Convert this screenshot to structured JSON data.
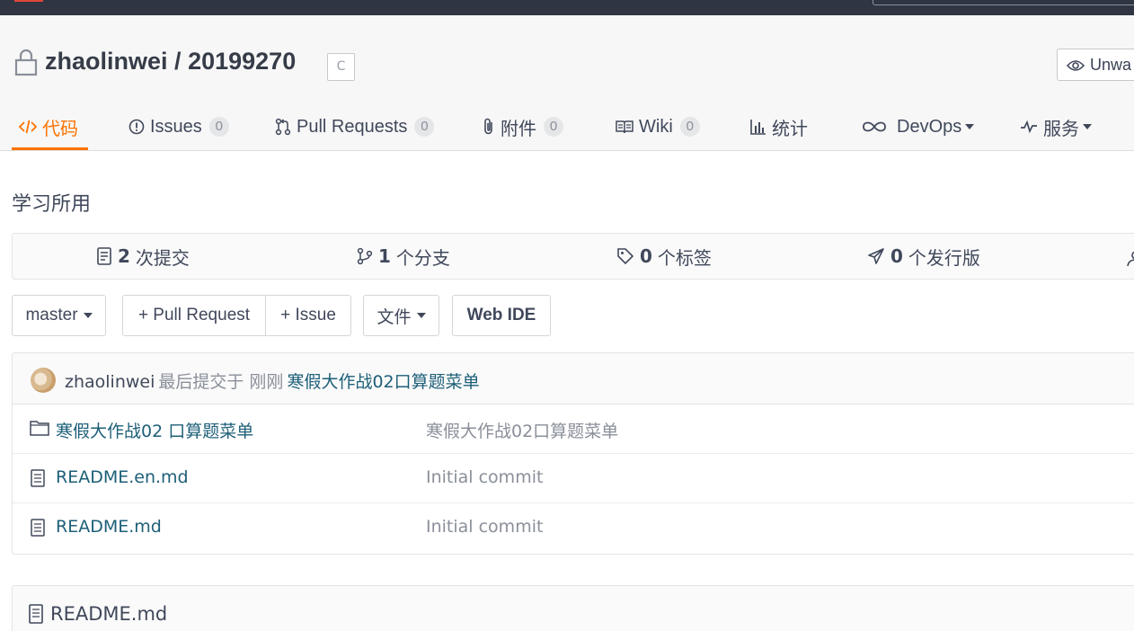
{
  "repo": {
    "owner": "zhaolinwei",
    "separator": "/",
    "name": "20199270",
    "badge": "C",
    "watch_label": "Unwa",
    "description": "学习所用"
  },
  "tabs": [
    {
      "label": "代码",
      "icon": "code-icon",
      "active": true
    },
    {
      "label": "Issues",
      "count": "0",
      "icon": "issue-icon"
    },
    {
      "label": "Pull Requests",
      "count": "0",
      "icon": "pull-request-icon"
    },
    {
      "label": "附件",
      "count": "0",
      "icon": "paperclip-icon"
    },
    {
      "label": "Wiki",
      "count": "0",
      "icon": "book-icon"
    },
    {
      "label": "统计",
      "icon": "bar-chart-icon"
    },
    {
      "label": "DevOps",
      "icon": "infinity-icon",
      "dropdown": true
    },
    {
      "label": "服务",
      "icon": "pulse-icon",
      "dropdown": true
    }
  ],
  "stats": [
    {
      "value": "2",
      "label": "次提交",
      "icon": "commit-log-icon"
    },
    {
      "value": "1",
      "label": "个分支",
      "icon": "branch-icon"
    },
    {
      "value": "0",
      "label": "个标签",
      "icon": "tag-icon"
    },
    {
      "value": "0",
      "label": "个发行版",
      "icon": "send-icon"
    }
  ],
  "toolbar": {
    "branch": "master",
    "pull_request": "+ Pull Request",
    "issue": "+ Issue",
    "file": "文件",
    "web_ide": "Web IDE"
  },
  "last_commit": {
    "author": "zhaolinwei",
    "meta": "最后提交于 刚刚",
    "message": "寒假大作战02口算题菜单"
  },
  "files": [
    {
      "name": "寒假大作战02 口算题菜单",
      "type": "folder",
      "message": "寒假大作战02口算题菜单"
    },
    {
      "name": "README.en.md",
      "type": "file",
      "message": "Initial commit"
    },
    {
      "name": "README.md",
      "type": "file",
      "message": "Initial commit"
    }
  ],
  "readme": {
    "title": "README.md"
  },
  "colors": {
    "accent": "#fe7300",
    "link": "#1d5f78",
    "muted": "#8a8f99",
    "topbar": "#2f3542"
  }
}
